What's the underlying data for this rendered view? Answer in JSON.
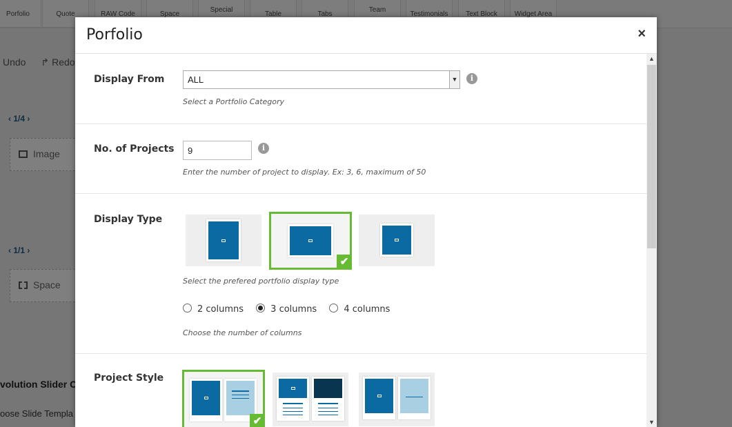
{
  "background": {
    "toolbar": [
      "Porfolio",
      "Quote",
      "RAW Code",
      "Space",
      "Special",
      "Table",
      "Tabs",
      "Team",
      "Testimonials",
      "Text Block",
      "Widget Area"
    ],
    "undo_label": "Undo",
    "redo_label": "Redo",
    "pager1": "1/4",
    "block1": "Image",
    "pager2": "1/1",
    "block2": "Space",
    "heading": "volution Slider C",
    "subtext": "oose Slide Templa"
  },
  "modal": {
    "title": "Porfolio",
    "close_label": "×",
    "display_from": {
      "label": "Display From",
      "value": "ALL",
      "help": "Select a Portfolio Category"
    },
    "num_projects": {
      "label": "No. of Projects",
      "value": "9",
      "help": "Enter the number of project to display. Ex: 3, 6, maximum of 50"
    },
    "display_type": {
      "label": "Display Type",
      "help": "Select the prefered portfolio display type",
      "selected_index": 1,
      "columns_options": [
        "2 columns",
        "3 columns",
        "4 columns"
      ],
      "columns_selected": "3 columns",
      "columns_help": "Choose the number of columns"
    },
    "project_style": {
      "label": "Project Style",
      "selected_index": 0
    }
  },
  "colors": {
    "accent_green": "#66bb33",
    "thumb_blue": "#0b6aa2"
  }
}
